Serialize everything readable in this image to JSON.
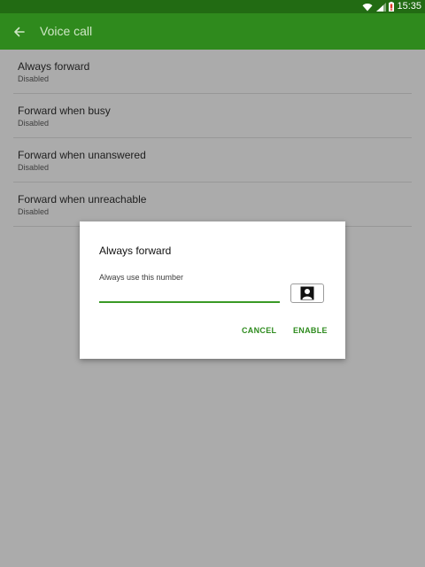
{
  "status_bar": {
    "time": "15:35",
    "icons": [
      "wifi-icon",
      "signal-icon",
      "battery-alert-icon"
    ],
    "background_color": "#226b13"
  },
  "app_bar": {
    "title": "Voice call",
    "back_icon": "arrow-left-icon",
    "background_color": "#2f8a1d"
  },
  "settings": {
    "items": [
      {
        "title": "Always forward",
        "status": "Disabled"
      },
      {
        "title": "Forward when busy",
        "status": "Disabled"
      },
      {
        "title": "Forward when unanswered",
        "status": "Disabled"
      },
      {
        "title": "Forward when unreachable",
        "status": "Disabled"
      }
    ]
  },
  "dialog": {
    "title": "Always forward",
    "field_label": "Always use this number",
    "number_value": "",
    "contacts_icon": "contact-person-icon",
    "cancel_label": "CANCEL",
    "enable_label": "ENABLE",
    "accent_color": "#2e8b1e"
  }
}
